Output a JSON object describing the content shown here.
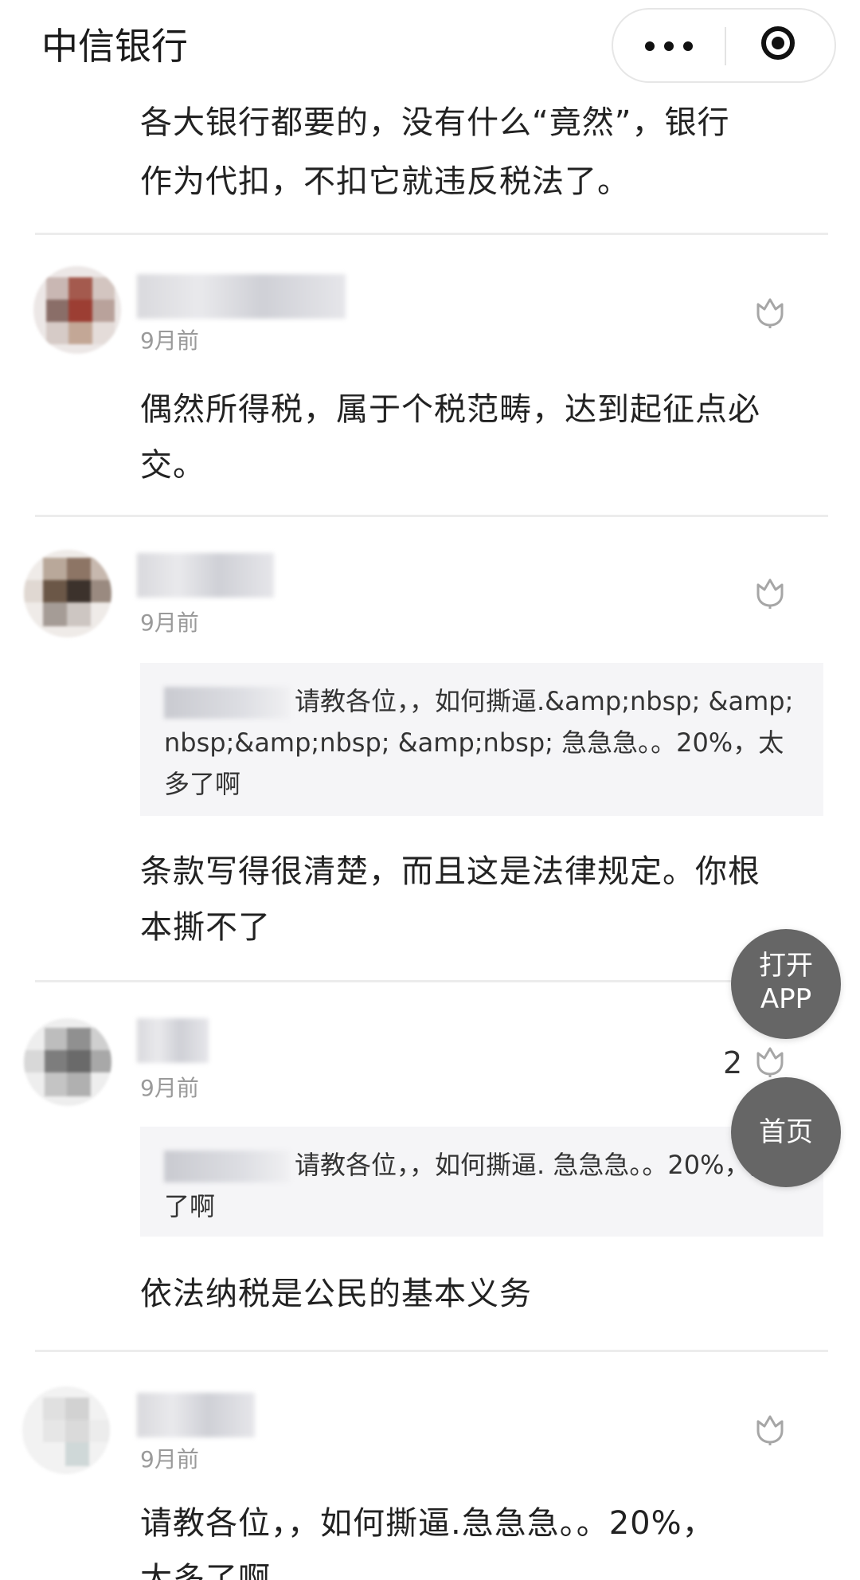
{
  "nav": {
    "title": "中信银行",
    "more_icon": "more-dots-icon",
    "close_icon": "target-icon"
  },
  "first_comment_tail": {
    "lines": [
      "各大银行都要的，没有什么“竟然”，银行",
      "作为代扣，不扣它就违反税法了。"
    ]
  },
  "comments": [
    {
      "time": "9月前",
      "like_count": "",
      "quote": null,
      "body_lines": [
        "偶然所得税，属于个税范畴，达到起征点必",
        "交。"
      ]
    },
    {
      "time": "9月前",
      "like_count": "",
      "quote": {
        "text": "请教各位，，如何撕逼.&amp;nbsp; &amp;nbsp;&amp;nbsp; &amp;nbsp; 急急急。。20%，太多了啊"
      },
      "body_lines": [
        "条款写得很清楚，而且这是法律规定。你根",
        "本撕不了"
      ]
    },
    {
      "time": "9月前",
      "like_count": "2",
      "quote": {
        "text": "请教各位，，如何撕逼. 急急急。。20%，太多了啊"
      },
      "body_lines": [
        "依法纳税是公民的基本义务"
      ]
    },
    {
      "time": "9月前",
      "like_count": "",
      "quote": null,
      "body_lines": [
        "请教各位，，如何撕逼.急急急。。20%，",
        "太多了啊"
      ]
    }
  ],
  "fab": {
    "open_app": [
      "打开",
      "APP"
    ],
    "home": "首页"
  }
}
